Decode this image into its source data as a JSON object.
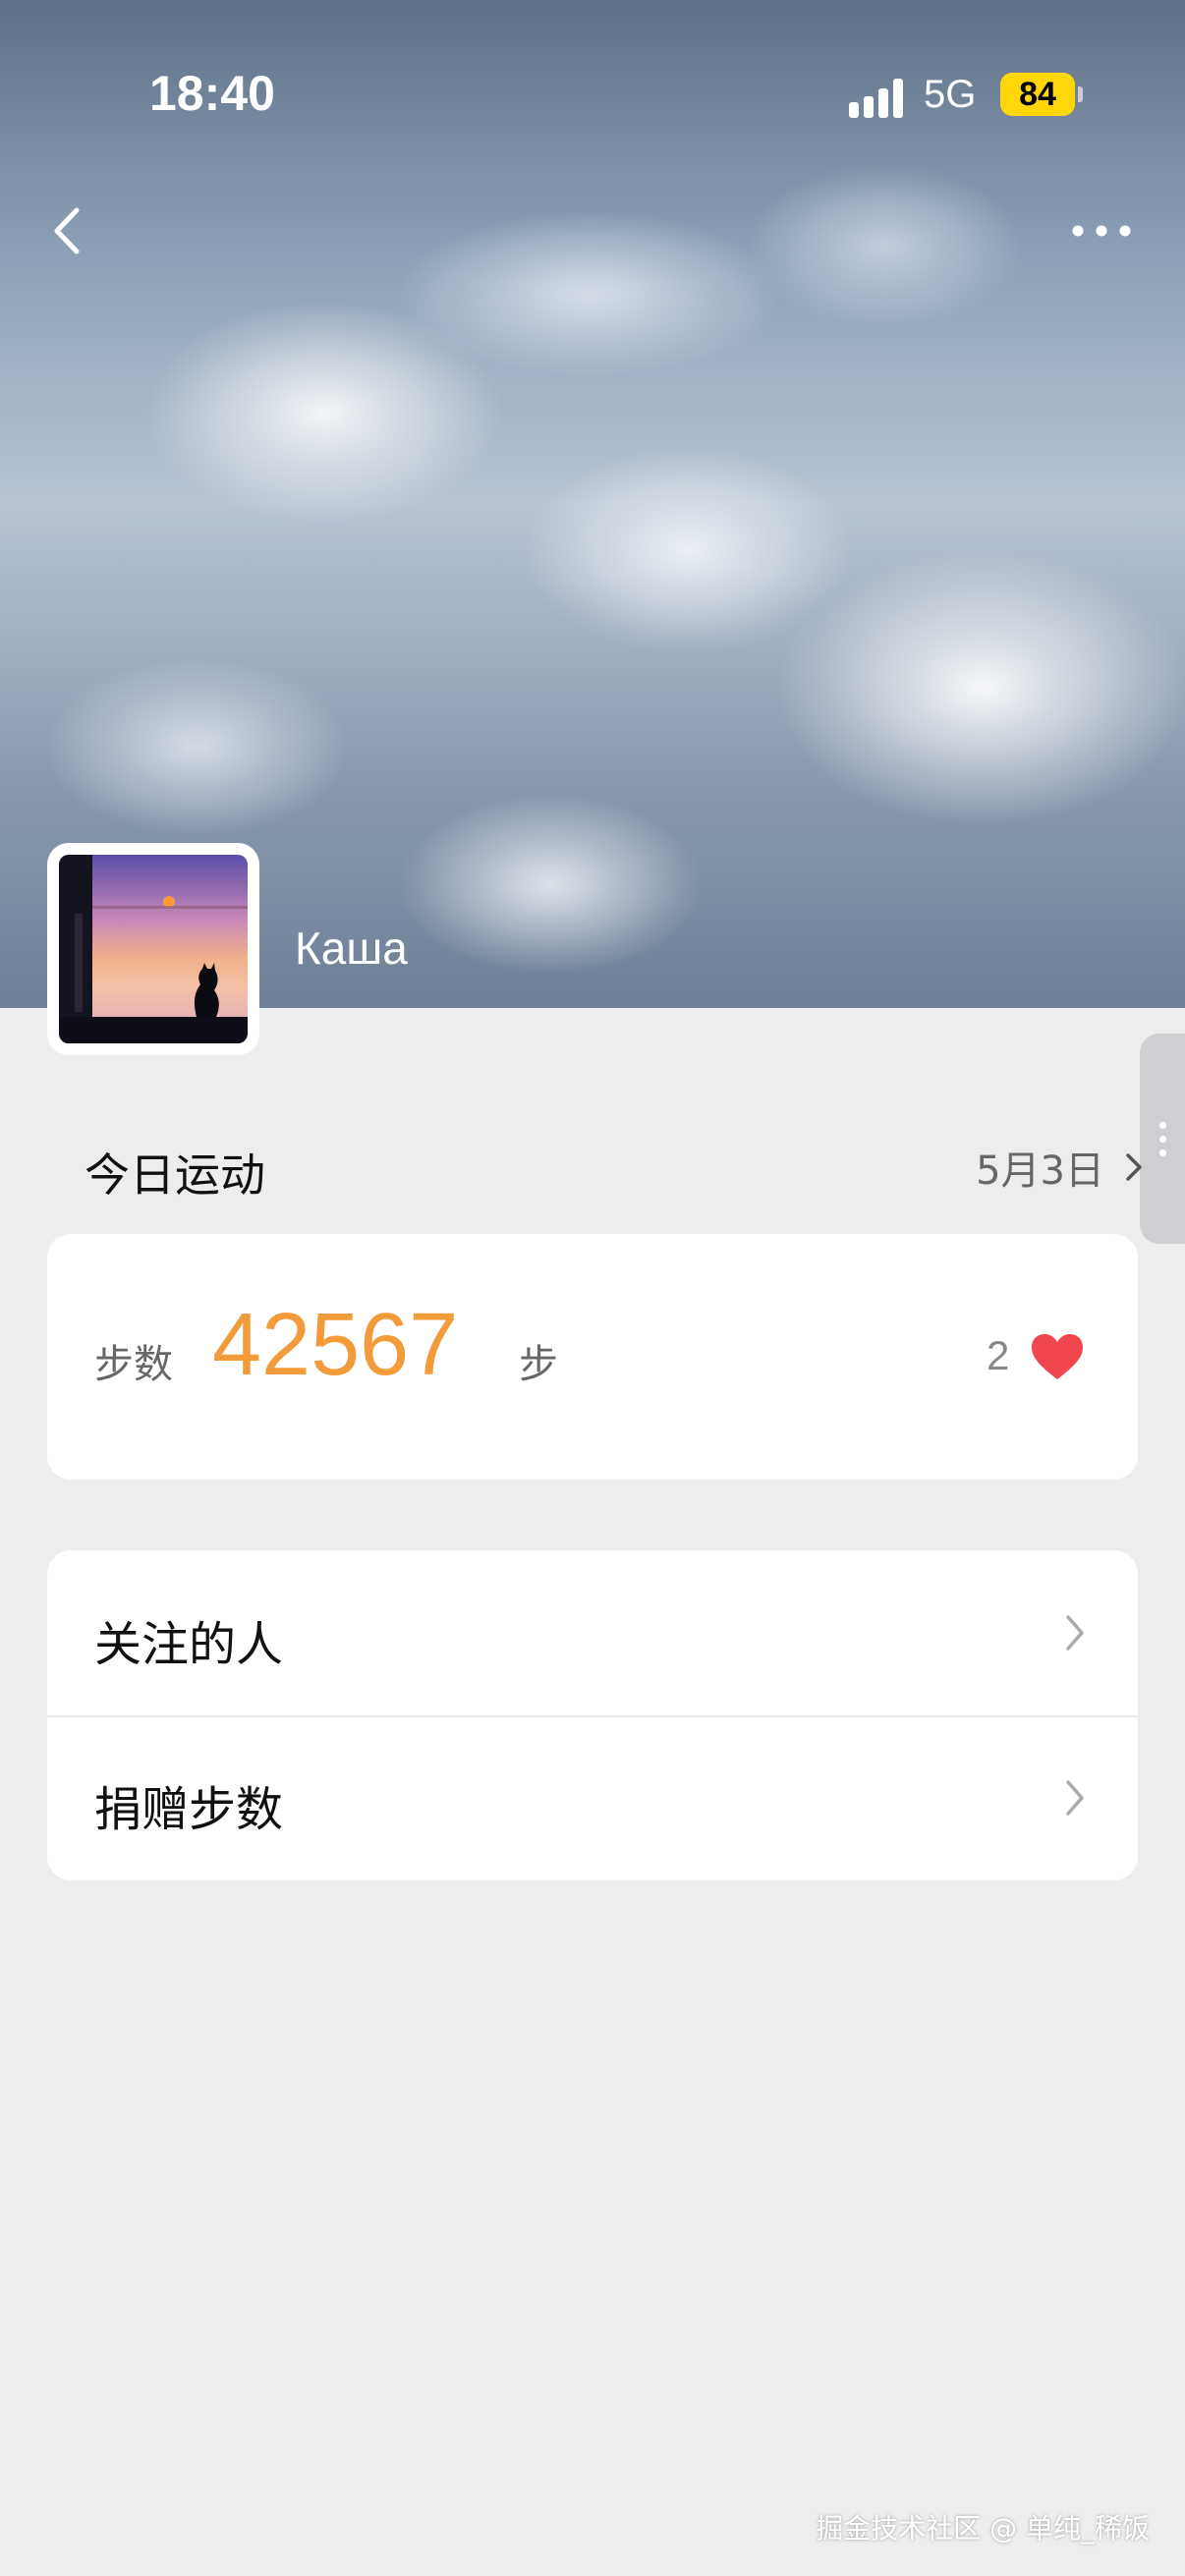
{
  "status_bar": {
    "time": "18:40",
    "network": "5G",
    "battery": "84"
  },
  "header": {
    "back_icon": "chevron-left-icon",
    "more_icon": "more-dots-icon"
  },
  "profile": {
    "name": "Каша",
    "avatar": "sunset-cat-window-photo"
  },
  "today": {
    "title": "今日运动",
    "date": "5月3日",
    "steps_label": "步数",
    "steps_value": "42567",
    "steps_unit": "步",
    "likes": "2"
  },
  "menu": {
    "items": [
      {
        "label": "关注的人"
      },
      {
        "label": "捐赠步数"
      }
    ]
  },
  "watermark": "掘金技术社区 @ 单纯_稀饭",
  "colors": {
    "accent": "#f29b3a",
    "heart": "#f0474f",
    "background": "#ededed"
  }
}
